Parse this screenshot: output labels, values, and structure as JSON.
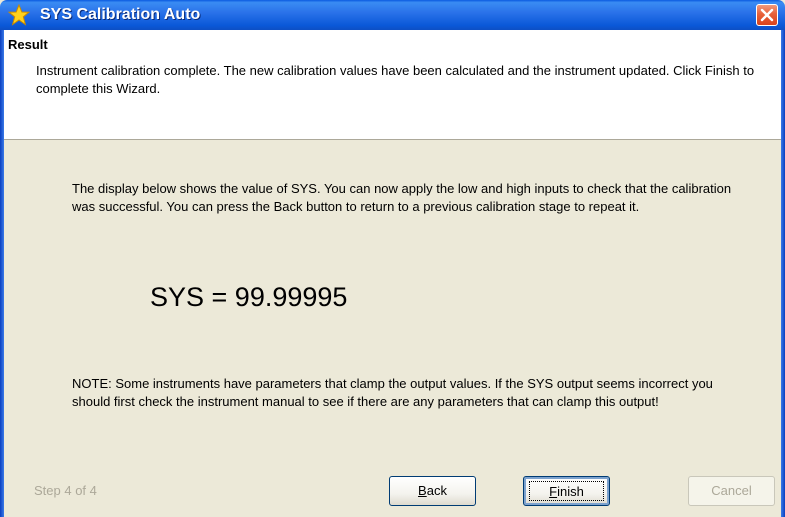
{
  "window": {
    "title": "SYS Calibration Auto",
    "icon": "star-icon",
    "close_icon": "close-icon"
  },
  "header": {
    "title": "Result",
    "description": "Instrument calibration complete. The new calibration values have been calculated and the instrument updated. Click Finish to complete this Wizard."
  },
  "body": {
    "intro": "The display below shows the value of SYS. You can now apply the low and high inputs to check that the calibration was successful. You can press the Back button to return to a previous calibration stage to repeat it.",
    "readout": "SYS = 99.99995",
    "note": "NOTE: Some instruments have parameters that clamp the output values. If the SYS output seems incorrect you should first check the instrument manual to see if there are any parameters that can clamp this output!"
  },
  "footer": {
    "step": "Step 4 of 4",
    "back_mnemonic": "B",
    "back_rest": "ack",
    "finish_mnemonic": "F",
    "finish_rest": "inish",
    "cancel_label": "Cancel"
  },
  "colors": {
    "titlebar": "#0a58d8",
    "close": "#e8613a",
    "dialog_bg": "#ece9d8",
    "disabled_text": "#aca899"
  }
}
